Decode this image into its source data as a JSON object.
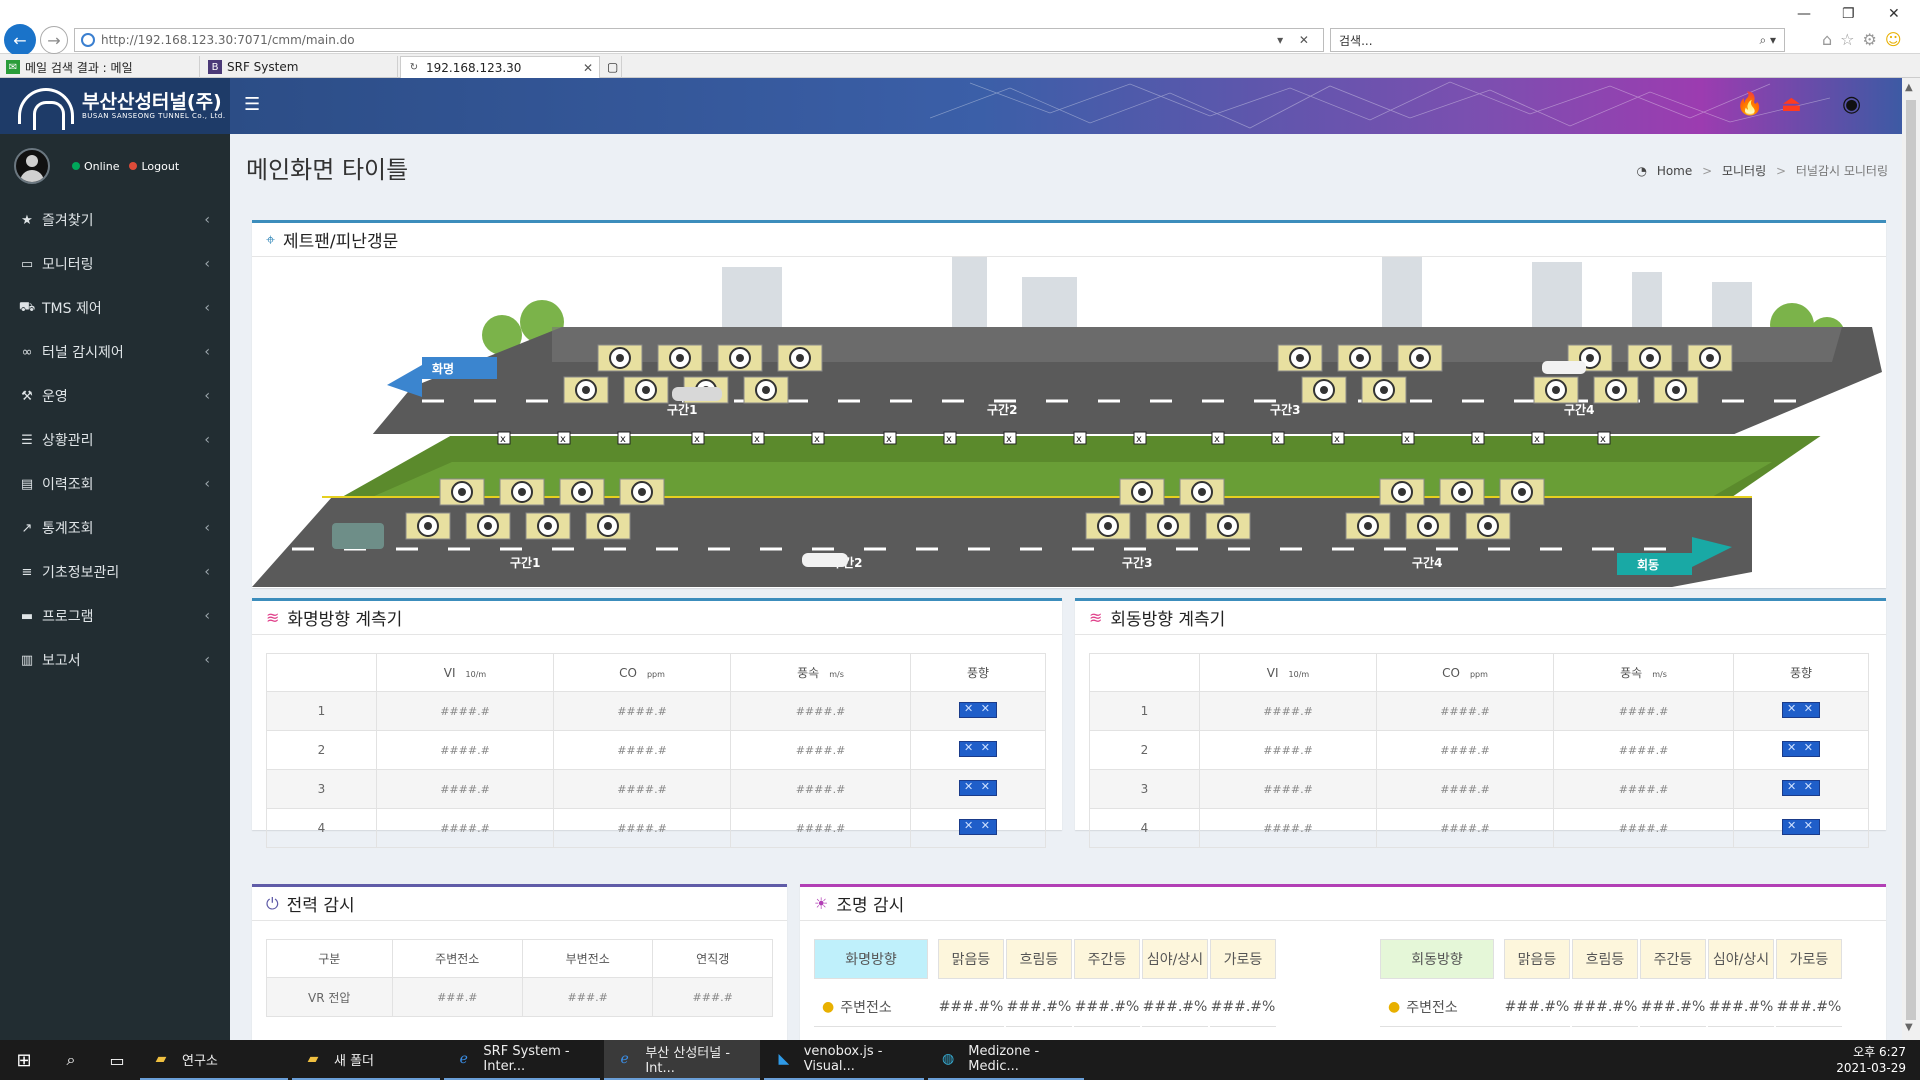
{
  "browser": {
    "url": "http://192.168.123.30:7071/cmm/main.do",
    "search_placeholder": "검색...",
    "tabs": [
      {
        "label": "메일 검색 결과 : 메일"
      },
      {
        "label": "SRF System"
      },
      {
        "label": "192.168.123.30"
      }
    ]
  },
  "sidebar": {
    "brand": "부산산성터널(주)",
    "brand_sub": "BUSAN SANSEONG TUNNEL Co., Ltd.",
    "online": "Online",
    "logout": "Logout",
    "items": [
      {
        "label": "즐겨찾기",
        "icon": "star-icon"
      },
      {
        "label": "모니터링",
        "icon": "monitor-icon"
      },
      {
        "label": "TMS 제어",
        "icon": "car-icon"
      },
      {
        "label": "터널 감시제어",
        "icon": "binoculars-icon"
      },
      {
        "label": "운영",
        "icon": "wrench-icon"
      },
      {
        "label": "상황관리",
        "icon": "server-icon"
      },
      {
        "label": "이력조회",
        "icon": "file-icon"
      },
      {
        "label": "통계조회",
        "icon": "chart-icon"
      },
      {
        "label": "기초정보관리",
        "icon": "sliders-icon"
      },
      {
        "label": "프로그램",
        "icon": "laptop-icon"
      },
      {
        "label": "보고서",
        "icon": "book-icon"
      }
    ]
  },
  "page": {
    "title": "메인화면 타이틀",
    "breadcrumb": [
      "Home",
      "모니터링",
      "터널감시 모니터링"
    ]
  },
  "tunnel_panel": {
    "title": "제트팬/피난갱문",
    "upper_sections": [
      "구간1",
      "구간2",
      "구간3",
      "구간4"
    ],
    "lower_sections": [
      "구간1",
      "구간2",
      "구간3",
      "구간4"
    ],
    "left_arrow": "화명",
    "right_arrow": "회동"
  },
  "meters": [
    {
      "title": "화명방향 계측기",
      "headers": [
        "VI",
        "CO",
        "풍속",
        "풍향"
      ],
      "units": [
        "10/m",
        "ppm",
        "m/s"
      ],
      "rows": [
        {
          "no": "1",
          "vi": "####.#",
          "co": "####.#",
          "speed": "####.#"
        },
        {
          "no": "2",
          "vi": "####.#",
          "co": "####.#",
          "speed": "####.#"
        },
        {
          "no": "3",
          "vi": "####.#",
          "co": "####.#",
          "speed": "####.#"
        },
        {
          "no": "4",
          "vi": "####.#",
          "co": "####.#",
          "speed": "####.#"
        }
      ]
    },
    {
      "title": "회동방향 계측기",
      "headers": [
        "VI",
        "CO",
        "풍속",
        "풍향"
      ],
      "units": [
        "10/m",
        "ppm",
        "m/s"
      ],
      "rows": [
        {
          "no": "1",
          "vi": "####.#",
          "co": "####.#",
          "speed": "####.#"
        },
        {
          "no": "2",
          "vi": "####.#",
          "co": "####.#",
          "speed": "####.#"
        },
        {
          "no": "3",
          "vi": "####.#",
          "co": "####.#",
          "speed": "####.#"
        },
        {
          "no": "4",
          "vi": "####.#",
          "co": "####.#",
          "speed": "####.#"
        }
      ]
    }
  ],
  "power": {
    "title": "전력 감시",
    "headers": [
      "구분",
      "주변전소",
      "부변전소",
      "연직갱"
    ],
    "rows": [
      {
        "label": "VR 전압",
        "v1": "###.#",
        "v2": "###.#",
        "v3": "###.#"
      }
    ]
  },
  "lighting": {
    "title": "조명 감시",
    "left_head": "화명방향",
    "right_head": "회동방향",
    "columns": [
      "맑음등",
      "흐림등",
      "주간등",
      "심야/상시",
      "가로등"
    ],
    "row_label": "주변전소",
    "row_values": [
      "###.#%",
      "###.#%",
      "###.#%",
      "###.#%",
      "###.#%"
    ]
  },
  "taskbar": {
    "apps": [
      "연구소",
      "새 폴더",
      "SRF System - Inter...",
      "부산 산성터널 - Int...",
      "venobox.js - Visual...",
      "Medizone - Medic..."
    ],
    "time": "오후 6:27",
    "date": "2021-03-29"
  }
}
